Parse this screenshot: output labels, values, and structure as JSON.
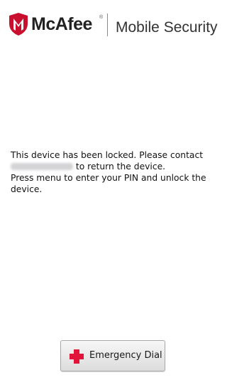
{
  "header": {
    "brand": "McAfee",
    "trademark": "®",
    "product": "Mobile Security",
    "brand_color": "#c8102e"
  },
  "message": {
    "line1": "This device has been locked. Please contact",
    "line2_after_contact": " to return the device.",
    "line3": "Press menu to enter your PIN and unlock the",
    "line4": "device."
  },
  "emergency": {
    "label": "Emergency Dial",
    "icon": "red-cross-icon",
    "icon_color": "#e2143a"
  }
}
